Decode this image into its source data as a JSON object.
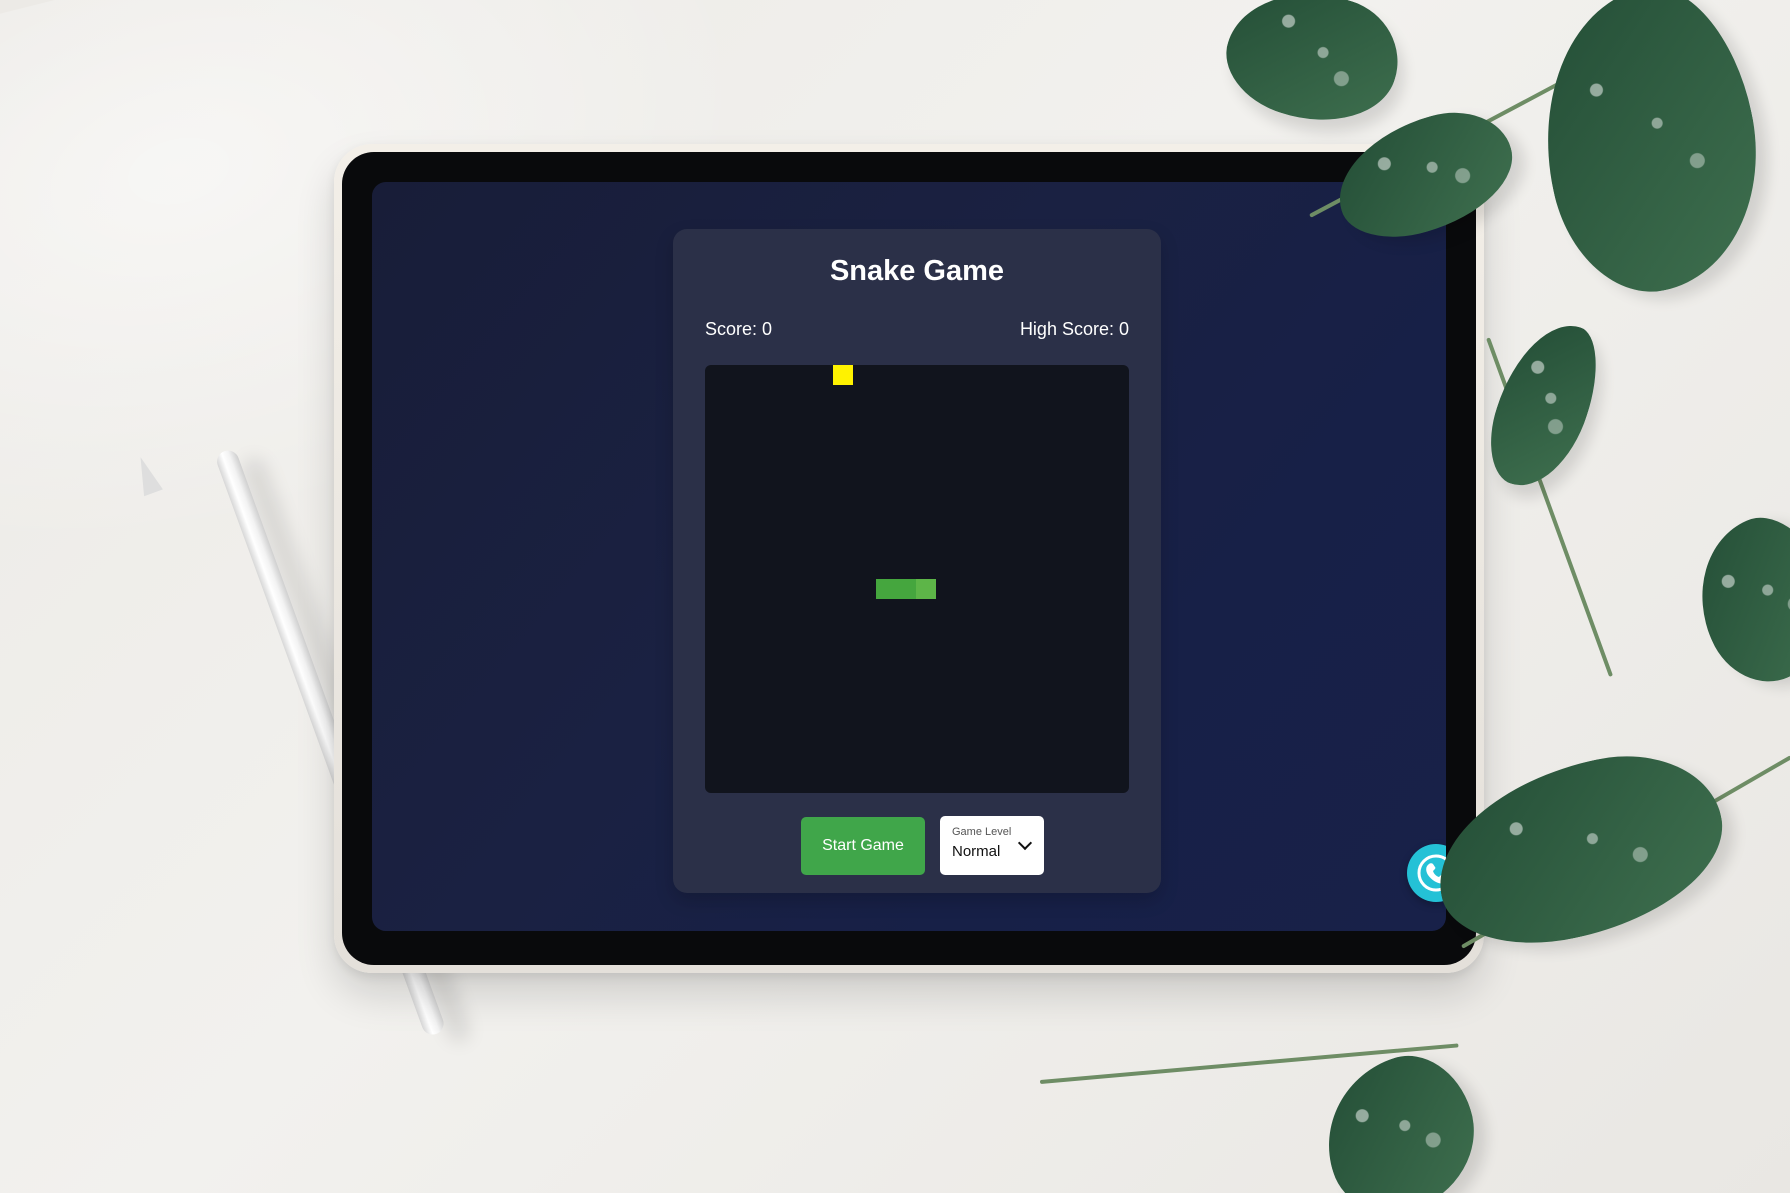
{
  "game": {
    "title": "Snake Game",
    "score_label": "Score: 0",
    "high_score_label": "High Score: 0",
    "start_button_label": "Start Game",
    "level": {
      "caption": "Game Level",
      "selected": "Normal"
    }
  },
  "icons": {
    "dropdown": "chevron-down-icon",
    "call": "phone-icon"
  },
  "colors": {
    "screen_background": "#1a2142",
    "card_background": "#2b3048",
    "board_background": "#11141d",
    "food": "#fff200",
    "snake": "#45a63e",
    "start_button": "#40a64a",
    "call_button": "#24c1d6"
  }
}
